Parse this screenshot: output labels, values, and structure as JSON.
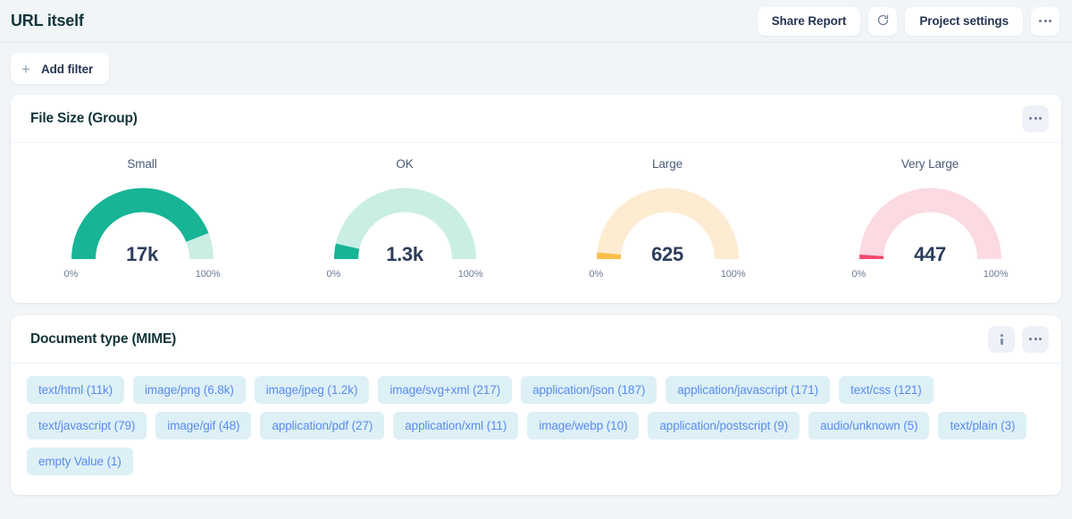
{
  "header": {
    "title": "URL itself",
    "share_report_label": "Share Report",
    "refresh_icon": "refresh-ccw-icon",
    "project_settings_label": "Project settings",
    "overflow_icon": "ellipsis-icon"
  },
  "filter_bar": {
    "plus_icon": "plus-icon",
    "add_filter_label": "Add filter"
  },
  "file_size_card": {
    "title": "File Size (Group)",
    "overflow_icon": "ellipsis-icon",
    "tick_min": "0%",
    "tick_max": "100%",
    "colors": {
      "small_fill": "#17b496",
      "small_track": "#c9eee4",
      "ok_fill": "#17b496",
      "ok_track": "#c9eee4",
      "large_fill": "#fbbe4b",
      "large_track": "#fdecd2",
      "very_large_fill": "#f4496d",
      "very_large_track": "#fbdae2"
    },
    "gauges": [
      {
        "label": "Small",
        "value": "17k",
        "percent": 88,
        "fill": "#17b496",
        "track": "#c9eee4"
      },
      {
        "label": "OK",
        "value": "1.3k",
        "percent": 7,
        "fill": "#17b496",
        "track": "#c9eee4"
      },
      {
        "label": "Large",
        "value": "625",
        "percent": 3,
        "fill": "#fbbe4b",
        "track": "#fdecd2"
      },
      {
        "label": "Very Large",
        "value": "447",
        "percent": 2,
        "fill": "#f4496d",
        "track": "#fbdae2"
      }
    ]
  },
  "mime_card": {
    "title": "Document type (MIME)",
    "info_icon": "info-icon",
    "overflow_icon": "ellipsis-icon",
    "tag_bg": "#ddf0f6",
    "tag_color": "#5a8bf0",
    "tags": [
      "text/html (11k)",
      "image/png (6.8k)",
      "image/jpeg (1.2k)",
      "image/svg+xml (217)",
      "application/json (187)",
      "application/javascript (171)",
      "text/css (121)",
      "text/javascript (79)",
      "image/gif (48)",
      "application/pdf (27)",
      "application/xml (11)",
      "image/webp (10)",
      "application/postscript (9)",
      "audio/unknown (5)",
      "text/plain (3)",
      "empty Value (1)"
    ]
  }
}
